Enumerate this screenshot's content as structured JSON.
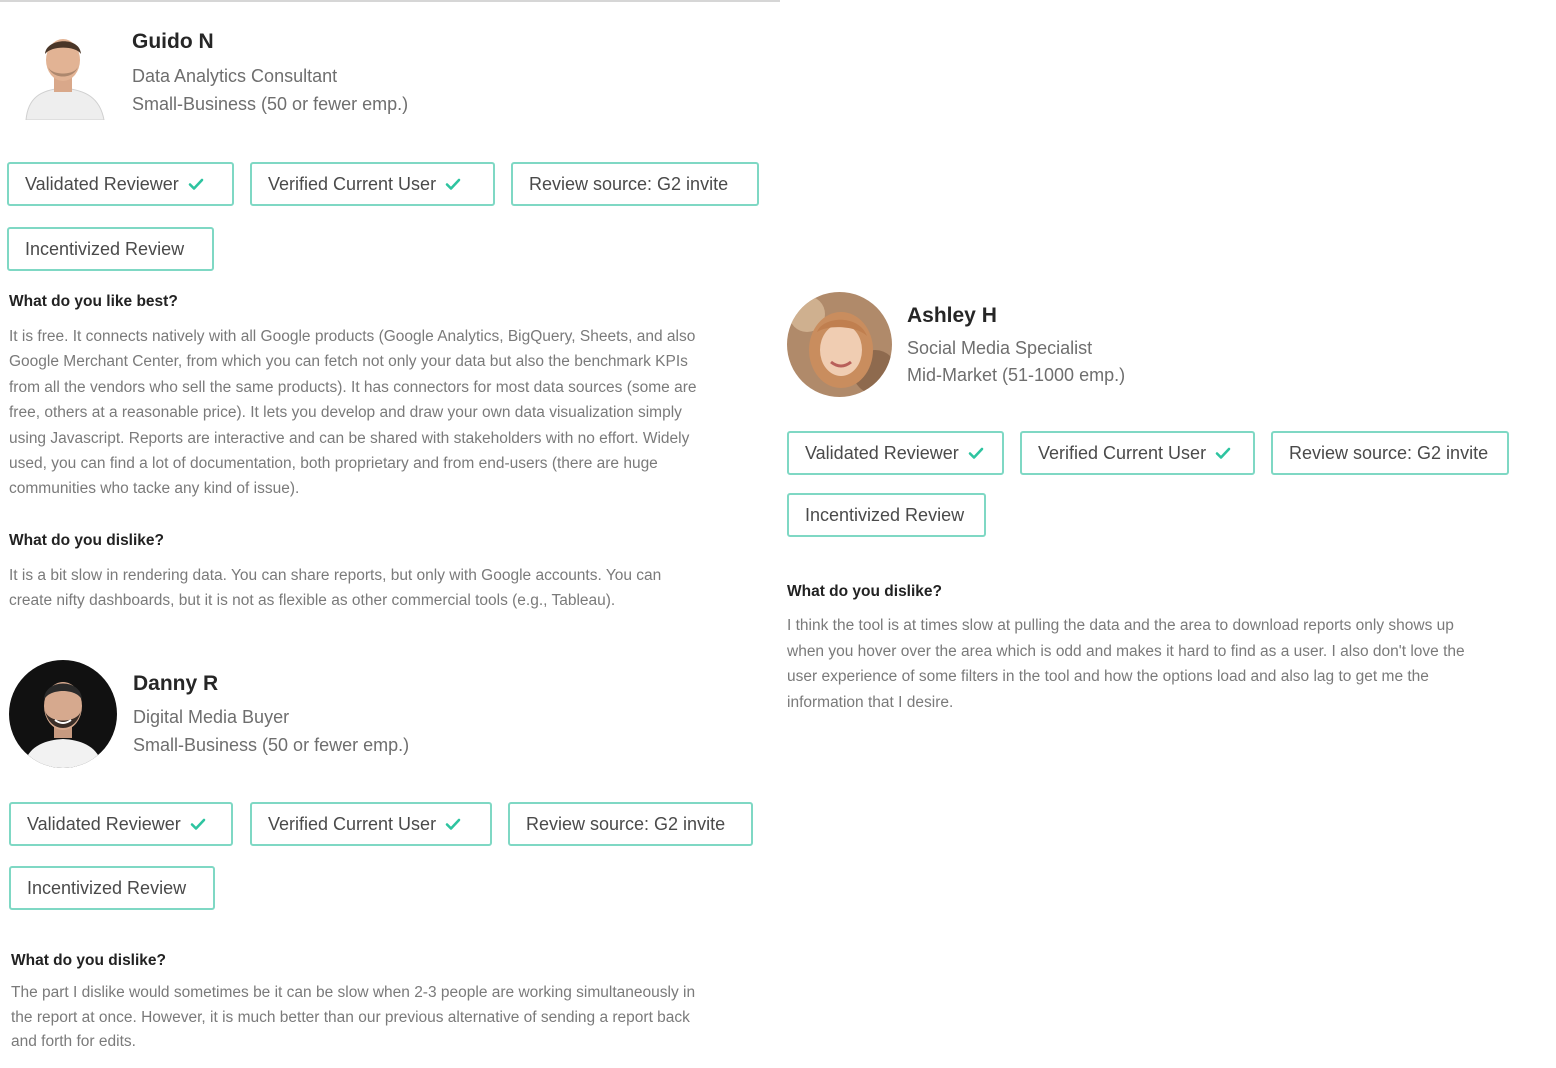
{
  "check_color": "#2ec4a0",
  "badge_border_color": "#7fd8c4",
  "reviews": [
    {
      "name": "Guido N",
      "role": "Data Analytics Consultant",
      "company": "Small-Business (50 or fewer emp.)",
      "badges": {
        "validated": "Validated Reviewer",
        "verified": "Verified Current User",
        "source": "Review source: G2 invite",
        "incentivized": "Incentivized Review"
      },
      "like_question": "What do you like best?",
      "like_lines": [
        "It is free. It connects natively with all Google products (Google Analytics, BigQuery, Sheets, and also",
        "Google Merchant Center, from which you can fetch not only your data but also the benchmark KPIs",
        "from all the vendors who sell the same products). It has connectors for most data sources (some are",
        "free, others at a reasonable price). It lets you develop and draw your own data visualization simply",
        "using Javascript. Reports are interactive and can be shared with stakeholders with no effort. Widely",
        "used, you can find a lot of documentation, both proprietary and from end-users (there are huge",
        "communities who tacke any kind of issue)."
      ],
      "dislike_question": "What do you dislike?",
      "dislike_lines": [
        "It is a bit slow in rendering data. You can share reports, but only with Google accounts. You can",
        "create nifty dashboards, but it is not as flexible as other commercial tools (e.g., Tableau)."
      ]
    },
    {
      "name": "Danny R",
      "role": "Digital Media Buyer",
      "company": "Small-Business (50 or fewer emp.)",
      "badges": {
        "validated": "Validated Reviewer",
        "verified": "Verified Current User",
        "source": "Review source: G2 invite",
        "incentivized": "Incentivized Review"
      },
      "dislike_question": "What do you dislike?",
      "dislike_lines": [
        "The part I dislike would sometimes be it can be slow when 2-3 people are working simultaneously in",
        "the report at once. However, it is much better than our previous alternative of sending a report back",
        "and forth for edits."
      ]
    },
    {
      "name": "Ashley H",
      "role": "Social Media Specialist",
      "company": "Mid-Market (51-1000 emp.)",
      "badges": {
        "validated": "Validated Reviewer",
        "verified": "Verified Current User",
        "source": "Review source: G2 invite",
        "incentivized": "Incentivized Review"
      },
      "dislike_question": "What do you dislike?",
      "dislike_lines": [
        "I think the tool is at times slow at pulling the data and the area to download reports only shows up",
        "when you hover over the area which is odd and makes it hard to find as a user. I also don't love the",
        "user experience of some filters in the tool and how the options load and also lag to get me the",
        "information that I desire."
      ]
    }
  ]
}
